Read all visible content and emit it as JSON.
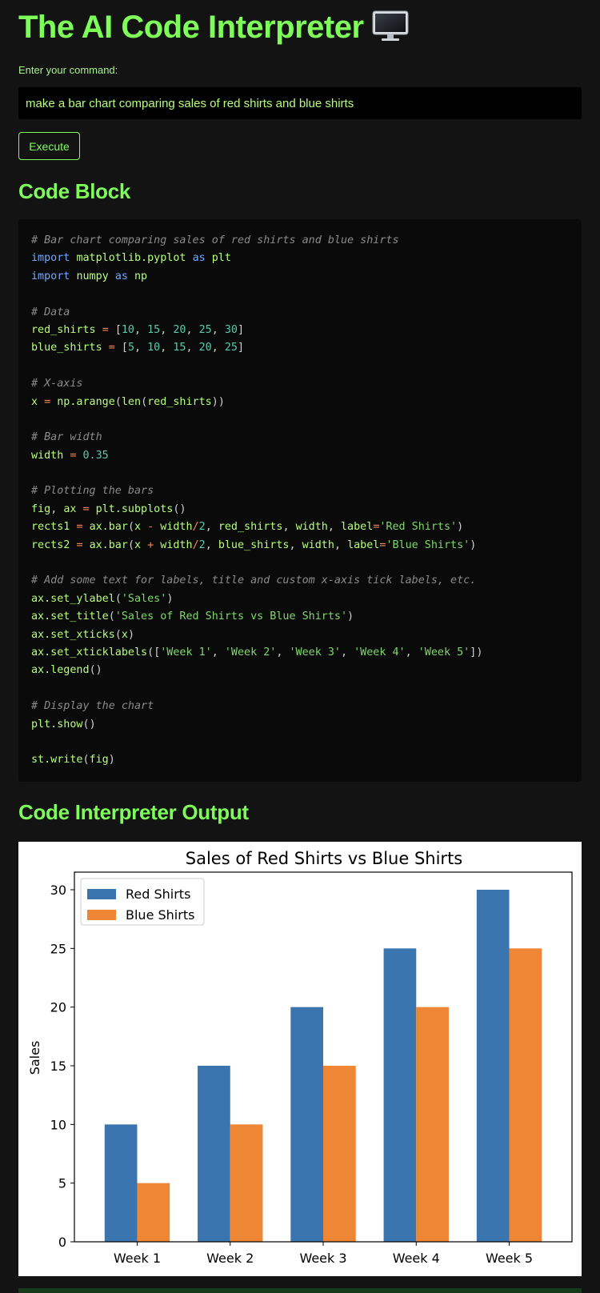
{
  "header": {
    "title": "The AI Code Interpreter",
    "title_icon": "desktop-computer-icon"
  },
  "command": {
    "label": "Enter your command:",
    "value": "make a bar chart comparing sales of red shirts and blue shirts",
    "execute_label": "Execute"
  },
  "code_section": {
    "heading": "Code Block",
    "lines": [
      "# Bar chart comparing sales of red shirts and blue shirts",
      "import matplotlib.pyplot as plt",
      "import numpy as np",
      "",
      "# Data",
      "red_shirts = [10, 15, 20, 25, 30]",
      "blue_shirts = [5, 10, 15, 20, 25]",
      "",
      "# X-axis",
      "x = np.arange(len(red_shirts))",
      "",
      "# Bar width",
      "width = 0.35",
      "",
      "# Plotting the bars",
      "fig, ax = plt.subplots()",
      "rects1 = ax.bar(x - width/2, red_shirts, width, label='Red Shirts')",
      "rects2 = ax.bar(x + width/2, blue_shirts, width, label='Blue Shirts')",
      "",
      "# Add some text for labels, title and custom x-axis tick labels, etc.",
      "ax.set_ylabel('Sales')",
      "ax.set_title('Sales of Red Shirts vs Blue Shirts')",
      "ax.set_xticks(x)",
      "ax.set_xticklabels(['Week 1', 'Week 2', 'Week 3', 'Week 4', 'Week 5'])",
      "ax.legend()",
      "",
      "# Display the chart",
      "plt.show()",
      "",
      "st.write(fig)"
    ]
  },
  "output_section": {
    "heading": "Code Interpreter Output"
  },
  "colors": {
    "accent": "#7dfc5a",
    "background": "#131313",
    "red_series": "#3a75b0",
    "blue_series": "#ef8636"
  },
  "chart_data": {
    "type": "bar",
    "title": "Sales of Red Shirts vs Blue Shirts",
    "xlabel": "",
    "ylabel": "Sales",
    "categories": [
      "Week 1",
      "Week 2",
      "Week 3",
      "Week 4",
      "Week 5"
    ],
    "series": [
      {
        "name": "Red Shirts",
        "values": [
          10,
          15,
          20,
          25,
          30
        ],
        "color": "#3a75b0"
      },
      {
        "name": "Blue Shirts",
        "values": [
          5,
          10,
          15,
          20,
          25
        ],
        "color": "#ef8636"
      }
    ],
    "yticks": [
      0,
      5,
      10,
      15,
      20,
      25,
      30
    ],
    "ylim": [
      0,
      31.5
    ],
    "legend": "top-left",
    "grid": false
  }
}
